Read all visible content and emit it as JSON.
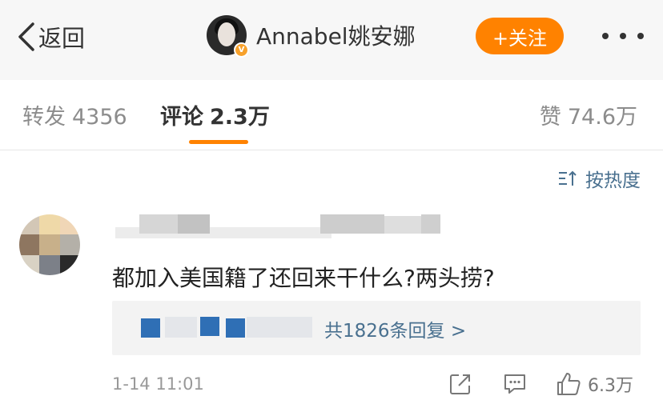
{
  "header": {
    "back_label": "返回",
    "username": "Annabel姚安娜",
    "follow_label": "+关注"
  },
  "tabs": [
    {
      "label": "转发",
      "count": "4356",
      "active": false
    },
    {
      "label": "评论",
      "count": "2.3万",
      "active": true
    },
    {
      "label": "赞",
      "count": "74.6万",
      "active": false
    }
  ],
  "sort": {
    "label": "按热度"
  },
  "comment": {
    "text": "都加入美国籍了还回来干什么?两头捞?",
    "replies_label": "共1826条回复 >",
    "time": "1-14 11:01",
    "likes": "6.3万"
  },
  "colors": {
    "accent_orange": "#ff8200",
    "link_blue": "#49708f",
    "verified_badge": "#f7a12b"
  },
  "icons": [
    "chevron-left-icon",
    "more-icon",
    "sort-icon",
    "share-icon",
    "comment-icon",
    "thumbs-up-icon"
  ]
}
